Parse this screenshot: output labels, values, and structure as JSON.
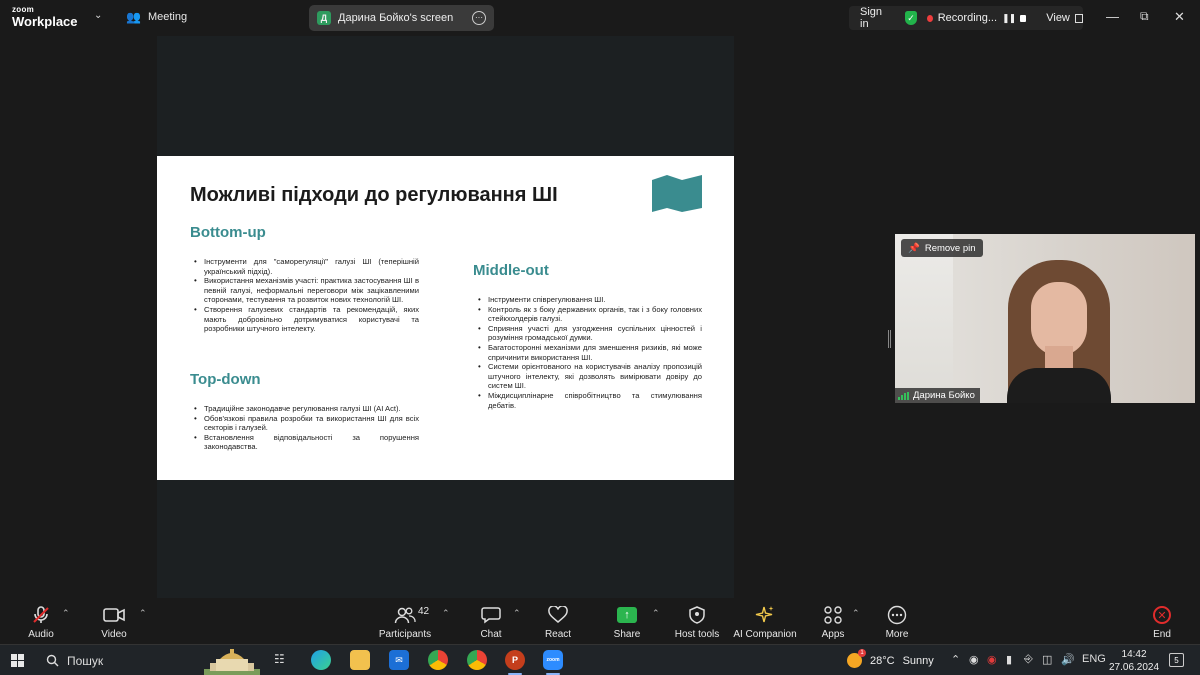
{
  "app": {
    "logo_line1": "zoom",
    "logo_line2": "Workplace",
    "meeting_label": "Meeting"
  },
  "topbar": {
    "screen_owner_initial": "Д",
    "screen_label": "Дарина Бойко's screen",
    "sign_in": "Sign in",
    "recording_label": "Recording...",
    "view_label": "View",
    "security_color": "#22b34b",
    "recording_color": "#ee3d3d"
  },
  "slide": {
    "title": "Можливі підходи до регулювання ШІ",
    "accent_color": "#3a8c8f",
    "bottom_up": {
      "heading": "Bottom-up",
      "items": [
        "Інструменти для \"саморегуляції\" галузі ШІ (теперішній український підхід).",
        "Використання механізмів участі: практика застосування ШІ в певній галузі, неформальні переговори між зацікавленими сторонами, тестування та розвиток нових технологій ШІ.",
        "Створення галузевих стандартів та рекомендацій, яких мають добровільно дотримуватися користувачі та розробники штучного інтелекту."
      ]
    },
    "top_down": {
      "heading": "Top-down",
      "items": [
        "Традиційне законодавче регулювання галузі ШІ (AI Act).",
        "Обов'язкові правила розробки та використання ШІ для всіх секторів і галузей.",
        "Встановлення відповідальності за порушення законодавства."
      ]
    },
    "middle_out": {
      "heading": "Middle-out",
      "items": [
        "Інструменти співрегулювання ШІ.",
        "Контроль як з боку державних органів, так і з боку головних стейкхолдерів галузі.",
        "Сприяння участі для узгодження суспільних цінностей і розуміння громадської думки.",
        "Багатосторонні механізми для зменшення ризиків, які може спричинити використання ШІ.",
        "Системи орієнтованого на користувачів аналізу пропозицій штучного інтелекту, які дозволять вимірювати довіру до систем ШІ.",
        "Міждисциплінарне співробітництво та стимулювання дебатів."
      ]
    }
  },
  "video": {
    "remove_pin": "Remove pin",
    "participant_name": "Дарина Бойко"
  },
  "toolbar": {
    "audio": "Audio",
    "video": "Video",
    "participants": "Participants",
    "participants_count": "42",
    "chat": "Chat",
    "react": "React",
    "share": "Share",
    "host_tools": "Host tools",
    "ai_companion": "AI Companion",
    "apps": "Apps",
    "more": "More",
    "end": "End",
    "share_color": "#2bb54f",
    "end_color": "#e02c2c"
  },
  "taskbar": {
    "search": "Пошук",
    "zoom_app_label": "zoom",
    "temperature": "28°C",
    "weather": "Sunny",
    "weather_alert": "1",
    "language": "ENG",
    "time": "14:42",
    "date": "27.06.2024",
    "notifications": "5"
  }
}
